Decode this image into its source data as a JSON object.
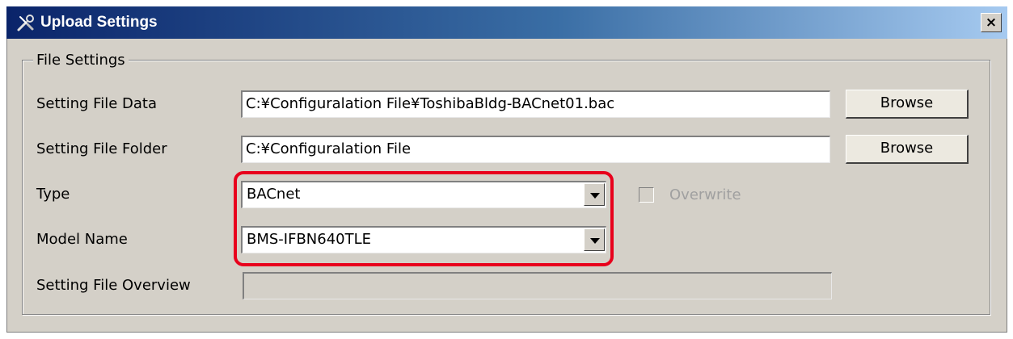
{
  "window": {
    "title": "Upload Settings",
    "title_icon": "wrench-screwdriver-icon",
    "close_label": "×"
  },
  "file_settings": {
    "legend": "File Settings",
    "setting_file_data": {
      "label": "Setting File Data",
      "value": "C:¥Configuralation File¥ToshibaBldg-BACnet01.bac",
      "browse_label": "Browse"
    },
    "setting_file_folder": {
      "label": "Setting File Folder",
      "value": "C:¥Configuralation File",
      "browse_label": "Browse"
    },
    "type": {
      "label": "Type",
      "selected": "BACnet"
    },
    "overwrite": {
      "label": "Overwrite",
      "checked": false,
      "enabled": false
    },
    "model_name": {
      "label": "Model Name",
      "selected": "BMS-IFBN640TLE"
    },
    "setting_file_overview": {
      "label": "Setting File Overview",
      "value": ""
    }
  },
  "colors": {
    "highlight": "#e8001c",
    "titlebar_start": "#0a246a",
    "titlebar_end": "#a6caf0"
  }
}
